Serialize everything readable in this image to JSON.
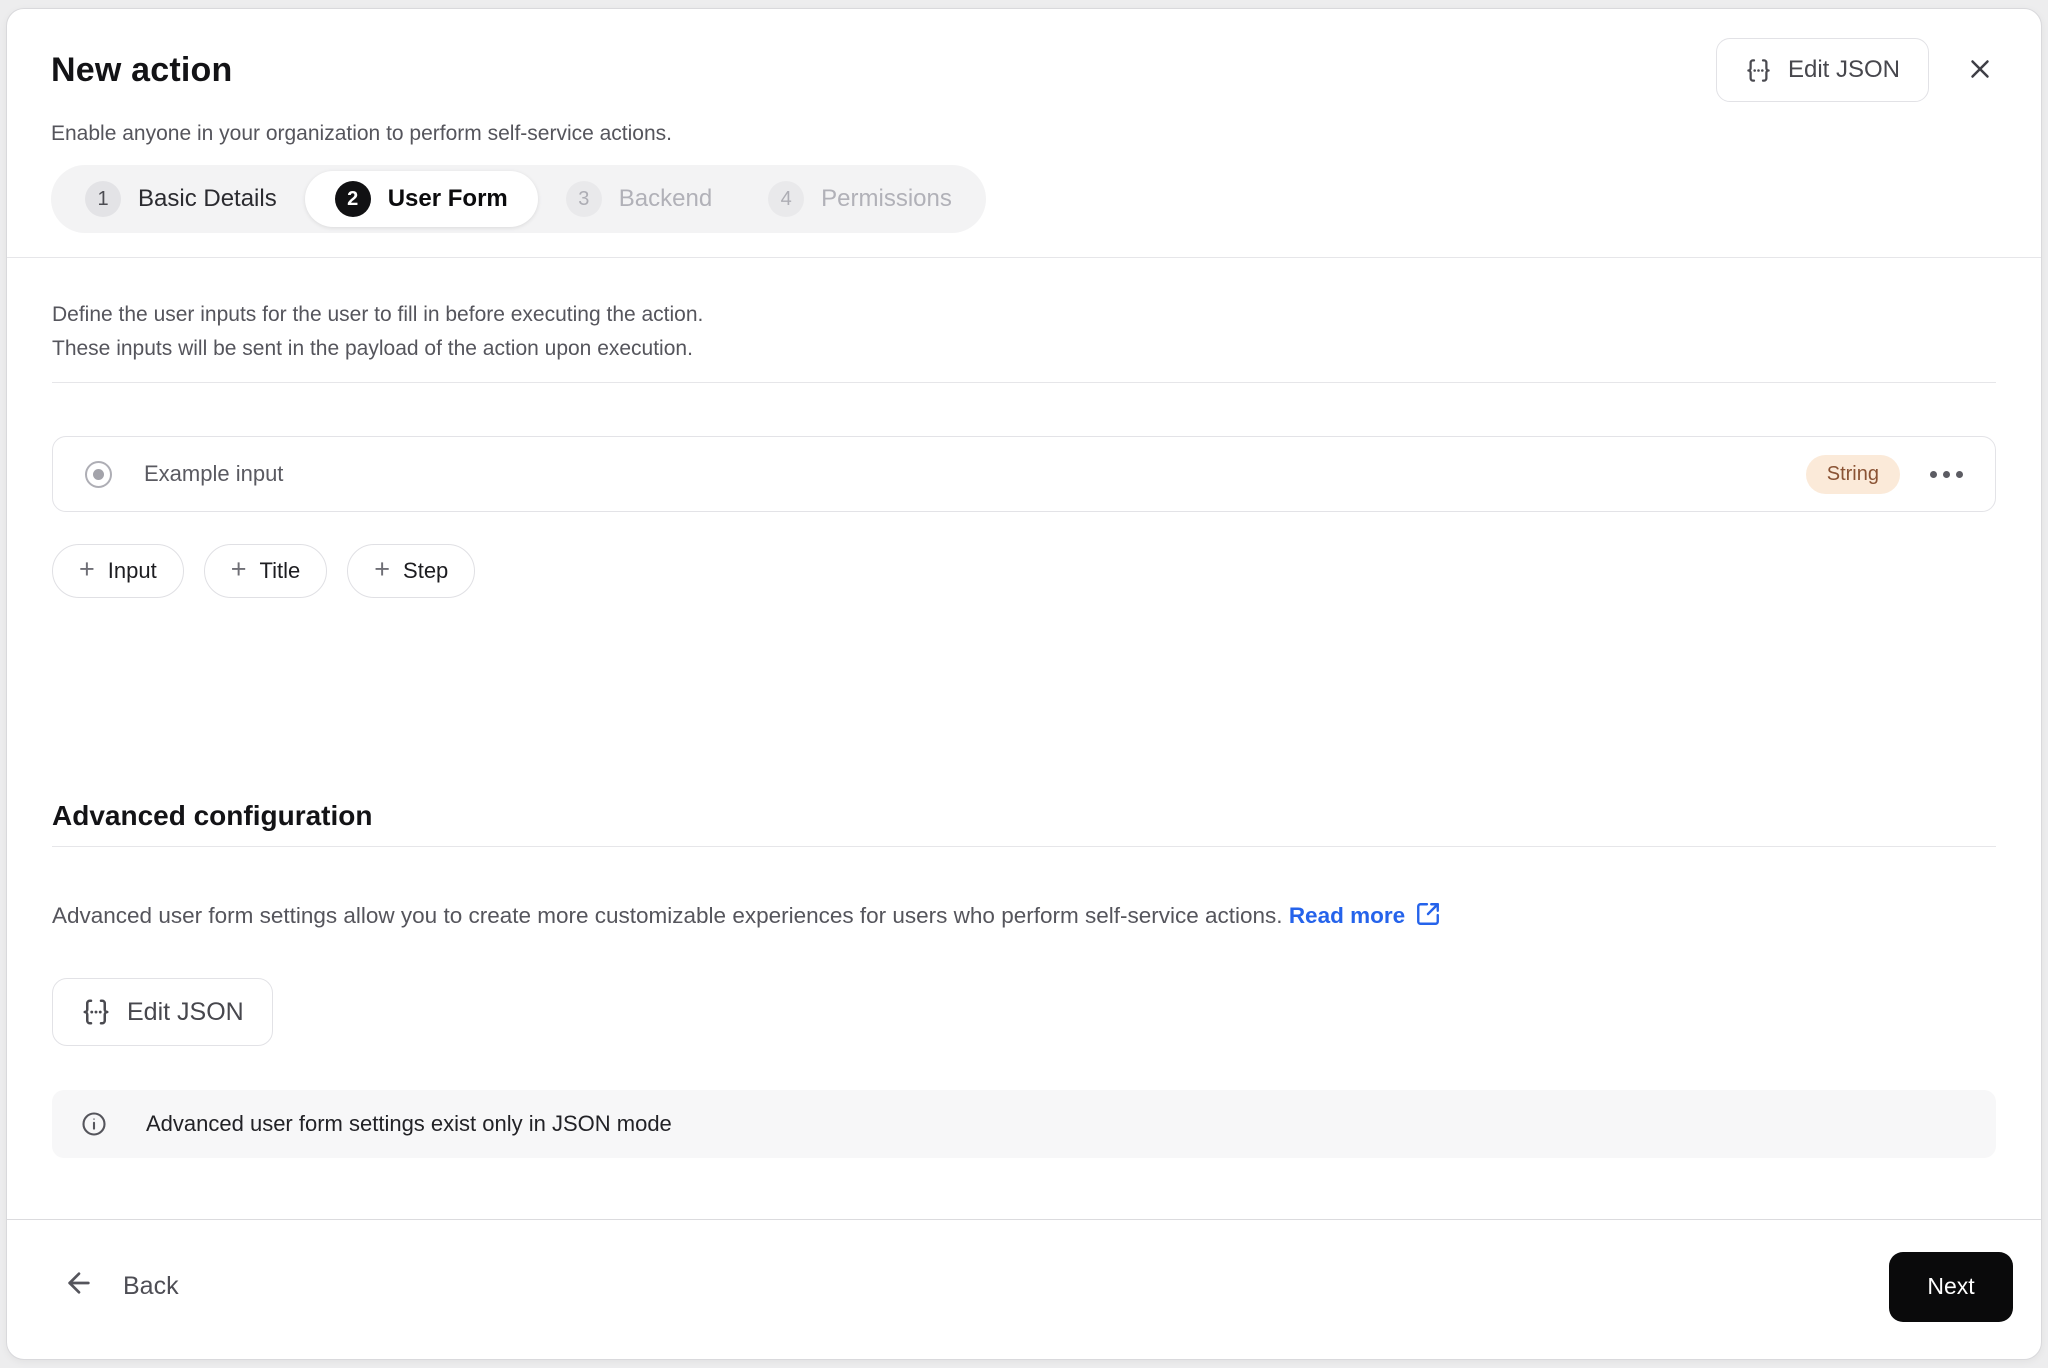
{
  "header": {
    "title": "New action",
    "subtitle": "Enable anyone in your organization to perform self-service actions.",
    "edit_json_label": "Edit JSON",
    "steps": [
      {
        "number": "1",
        "label": "Basic Details",
        "state": "complete"
      },
      {
        "number": "2",
        "label": "User Form",
        "state": "active"
      },
      {
        "number": "3",
        "label": "Backend",
        "state": "upcoming"
      },
      {
        "number": "4",
        "label": "Permissions",
        "state": "upcoming"
      }
    ]
  },
  "form_section": {
    "description_line1": "Define the user inputs for the user to fill in before executing the action.",
    "description_line2": "These inputs will be sent in the payload of the action upon execution.",
    "input_row": {
      "label": "Example input",
      "type_badge": "String"
    },
    "add_buttons": [
      {
        "label": "Input"
      },
      {
        "label": "Title"
      },
      {
        "label": "Step"
      }
    ],
    "plus_glyph": "+"
  },
  "advanced": {
    "heading": "Advanced configuration",
    "description": "Advanced user form settings allow you to create more customizable experiences for users who perform self-service actions.",
    "read_more_label": "Read more",
    "edit_json_label": "Edit JSON",
    "info_banner": "Advanced user form settings exist only in JSON mode"
  },
  "footer": {
    "back_label": "Back",
    "next_label": "Next"
  },
  "colors": {
    "link_blue": "#2563eb",
    "badge_bg": "#fbead9",
    "badge_text": "#8a5334",
    "next_button_bg": "#0a0a0b",
    "stepper_bg": "#f3f3f4",
    "active_step_circle": "#111113"
  }
}
